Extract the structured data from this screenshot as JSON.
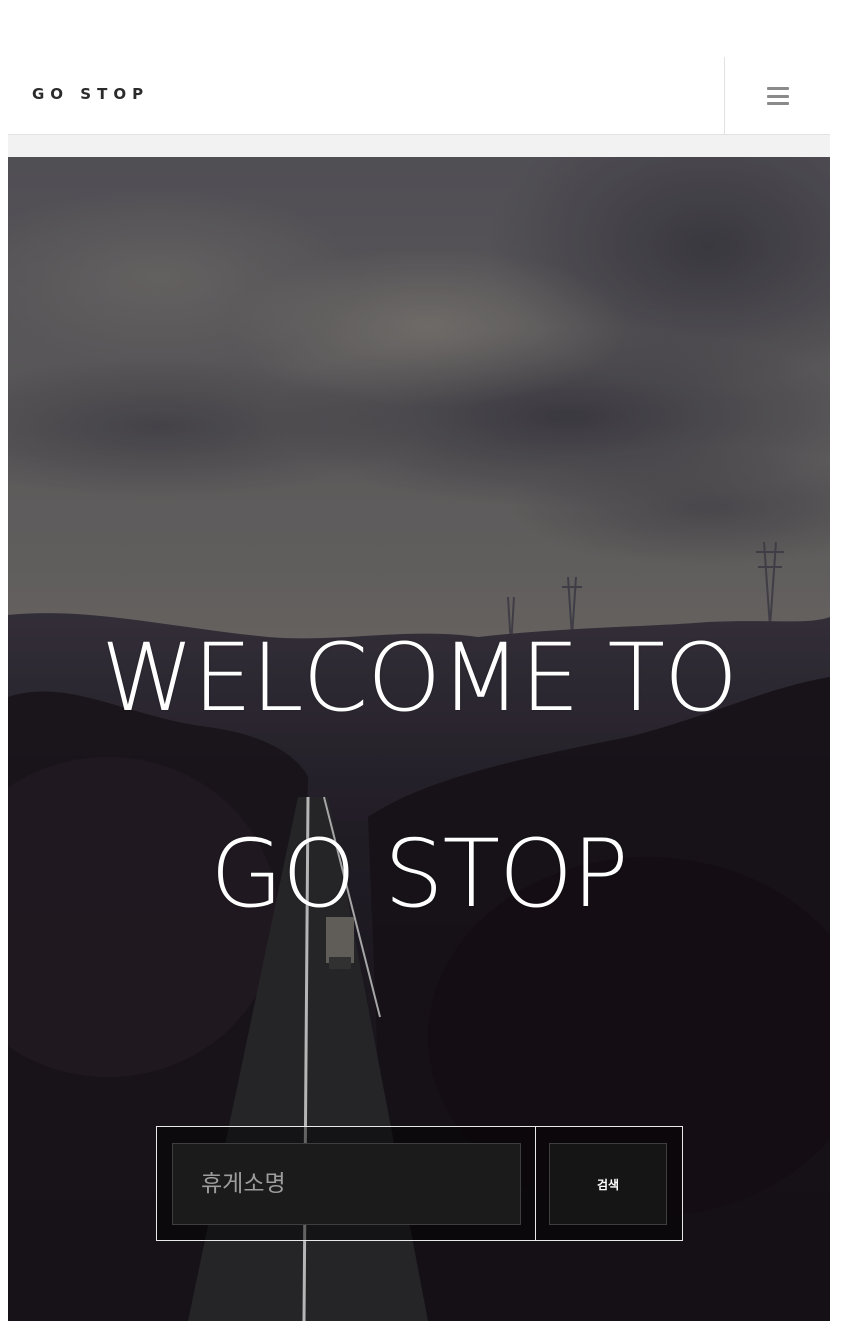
{
  "navbar": {
    "brand": "GO STOP",
    "menu_icon": "hamburger-menu-icon"
  },
  "hero": {
    "title_line1": "WELCOME TO",
    "title_line2": "GO STOP",
    "background": "dusk-highway-photo"
  },
  "search": {
    "placeholder": "휴게소명",
    "value": "",
    "button_label": "검색"
  },
  "colors": {
    "nav_bg": "#ffffff",
    "brand_text": "#2b2b2b",
    "hero_text": "#ffffff",
    "search_bg": "#1b1b1b",
    "search_border": "#e8e8e8"
  }
}
